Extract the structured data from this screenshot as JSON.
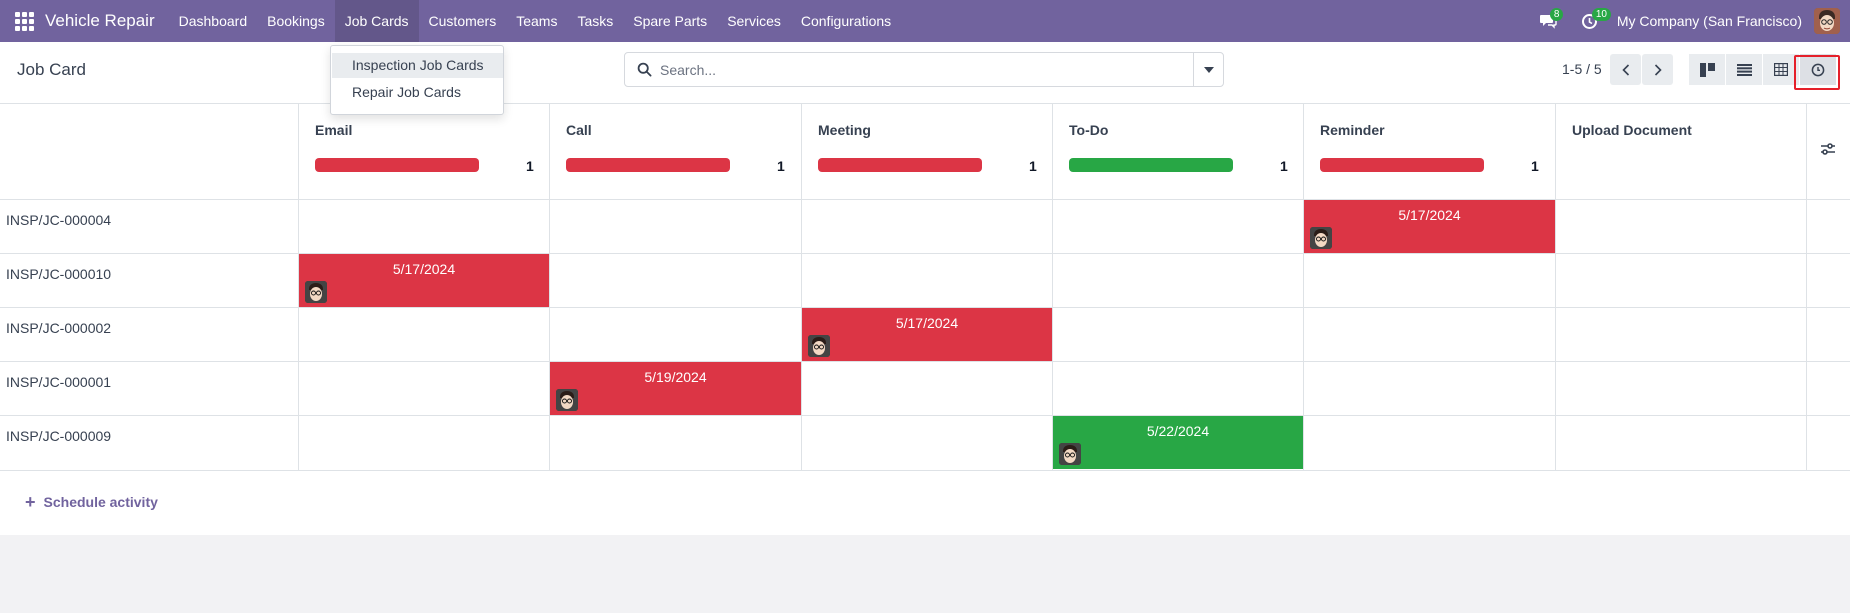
{
  "navbar": {
    "app_name": "Vehicle Repair",
    "menu": [
      "Dashboard",
      "Bookings",
      "Job Cards",
      "Customers",
      "Teams",
      "Tasks",
      "Spare Parts",
      "Services",
      "Configurations"
    ],
    "messages_count": "8",
    "activities_count": "10",
    "company": "My Company (San Francisco)"
  },
  "control": {
    "page_title": "Job Card",
    "search_placeholder": "Search...",
    "pager": "1-5 / 5",
    "views": [
      "kanban-view-icon",
      "list-view-icon",
      "pivot-view-icon",
      "activity-view-icon"
    ],
    "active_view": "activity-view-icon"
  },
  "dropdown": {
    "items": [
      "Inspection Job Cards",
      "Repair Job Cards"
    ]
  },
  "grid": {
    "columns": [
      {
        "title": "Email",
        "count": "1",
        "bar_color": "#dc3545"
      },
      {
        "title": "Call",
        "count": "1",
        "bar_color": "#dc3545"
      },
      {
        "title": "Meeting",
        "count": "1",
        "bar_color": "#dc3545"
      },
      {
        "title": "To-Do",
        "count": "1",
        "bar_color": "#28a745"
      },
      {
        "title": "Reminder",
        "count": "1",
        "bar_color": "#dc3545"
      },
      {
        "title": "Upload Document",
        "count": "",
        "bar_color": ""
      }
    ],
    "rows": [
      {
        "label": "INSP/JC-000004",
        "activity_column": "Reminder",
        "date": "5/17/2024",
        "color": "#dc3545"
      },
      {
        "label": "INSP/JC-000010",
        "activity_column": "Email",
        "date": "5/17/2024",
        "color": "#dc3545"
      },
      {
        "label": "INSP/JC-000002",
        "activity_column": "Meeting",
        "date": "5/17/2024",
        "color": "#dc3545"
      },
      {
        "label": "INSP/JC-000001",
        "activity_column": "Call",
        "date": "5/19/2024",
        "color": "#dc3545"
      },
      {
        "label": "INSP/JC-000009",
        "activity_column": "To-Do",
        "date": "5/22/2024",
        "color": "#28a745"
      }
    ]
  },
  "footer": {
    "schedule_label": "Schedule activity"
  }
}
